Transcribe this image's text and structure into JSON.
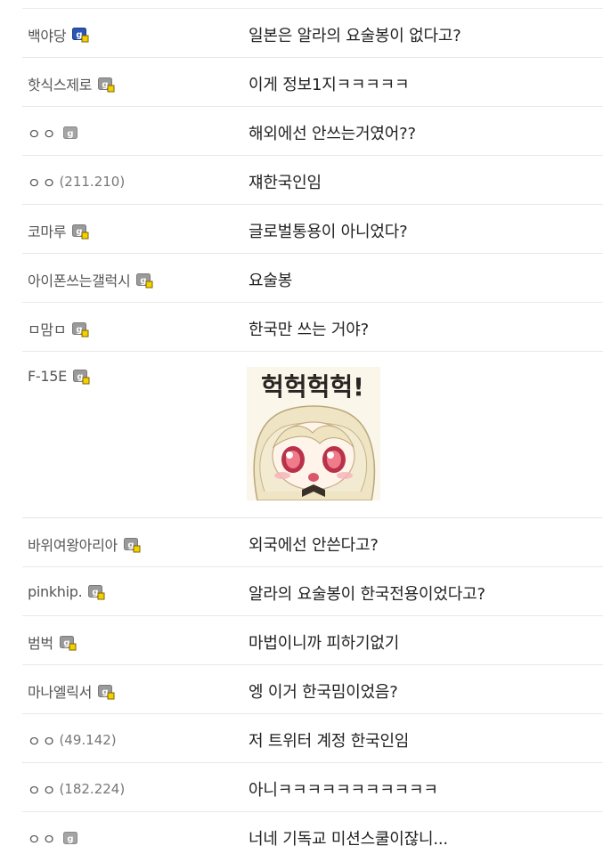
{
  "comments": [
    {
      "nick": "백야당",
      "ip": "",
      "badge": "blue-fixed-user-icon",
      "text": "일본은 알라의 요술봉이 없다고?"
    },
    {
      "nick": "핫식스제로",
      "ip": "",
      "badge": "gray-fixed-user-icon",
      "text": "이게 정보1지ㅋㅋㅋㅋㅋ"
    },
    {
      "nick": "ㅇㅇ",
      "ip": "",
      "badge": "gray-semi-fixed-icon",
      "text": "해외에선 안쓰는거였어??"
    },
    {
      "nick": "ㅇㅇ",
      "ip": "(211.210)",
      "badge": "",
      "text": "쟤한국인임"
    },
    {
      "nick": "코마루",
      "ip": "",
      "badge": "gray-fixed-user-icon",
      "text": "글로벌통용이 아니었다?"
    },
    {
      "nick": "아이폰쓰는갤럭시",
      "ip": "",
      "badge": "gray-fixed-user-icon",
      "text": "요술봉"
    },
    {
      "nick": "ㅁ맘ㅁ",
      "ip": "",
      "badge": "gray-fixed-user-icon",
      "text": "한국만 쓰는 거야?"
    },
    {
      "nick": "F-15E",
      "ip": "",
      "badge": "gray-fixed-user-icon",
      "text": "",
      "dccon_caption": "헉헉헉헉!"
    },
    {
      "nick": "바위여왕아리아",
      "ip": "",
      "badge": "gray-fixed-user-icon",
      "text": "외국에선 안쓴다고?"
    },
    {
      "nick": "pinkhip.",
      "ip": "",
      "badge": "gray-fixed-user-icon",
      "text": "알라의 요술봉이 한국전용이었다고?"
    },
    {
      "nick": "범벅",
      "ip": "",
      "badge": "gray-fixed-user-icon",
      "text": "마법이니까 피하기없기"
    },
    {
      "nick": "마나엘릭서",
      "ip": "",
      "badge": "gray-fixed-user-icon",
      "text": "엥 이거 한국밈이었음?"
    },
    {
      "nick": "ㅇㅇ",
      "ip": "(49.142)",
      "badge": "",
      "text": "저 트위터 계정 한국인임"
    },
    {
      "nick": "ㅇㅇ",
      "ip": "(182.224)",
      "badge": "",
      "text": "아니ㅋㅋㅋㅋㅋㅋㅋㅋㅋㅋㅋ"
    },
    {
      "nick": "ㅇㅇ",
      "ip": "",
      "badge": "gray-semi-fixed-icon",
      "text": "너네 기독교 미션스쿨이잖니..."
    }
  ]
}
